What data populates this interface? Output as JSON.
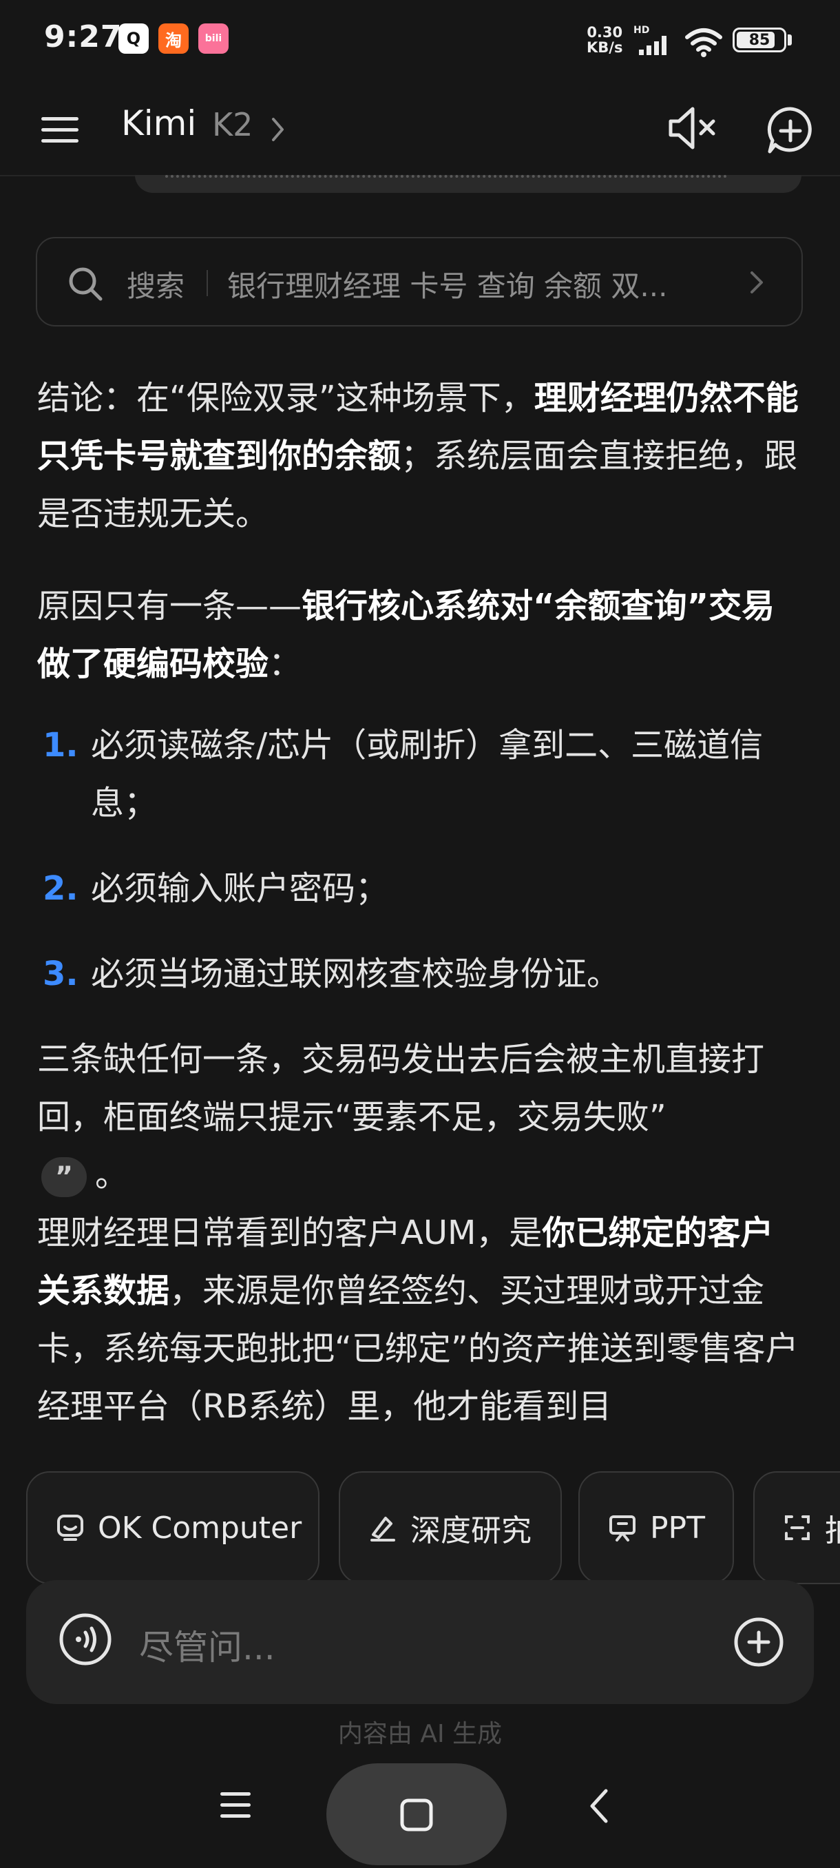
{
  "status_bar": {
    "time": "9:27",
    "app_icons": [
      {
        "name": "qq-icon",
        "glyph": "Q"
      },
      {
        "name": "taobao-icon",
        "glyph": "淘"
      },
      {
        "name": "bilibili-icon",
        "glyph": "bili"
      }
    ],
    "net_speed": "0.30",
    "net_unit": "KB/s",
    "hd_label": "HD",
    "battery": "85",
    "battery_level": 0.85
  },
  "header": {
    "title": "Kimi",
    "model": "K2"
  },
  "search": {
    "label": "搜索",
    "query": "银行理财经理 卡号 查询 余额 双..."
  },
  "message": {
    "p1_a": "结论：在“保险双录”这种场景下，",
    "p1_b": "理财经理仍然不能只凭卡号就查到你的余额",
    "p1_c": "；系统层面会直接拒绝，跟是否违规无关。",
    "p2_a": "原因只有一条——",
    "p2_b": "银行核心系统对“余额查询”交易做了硬编码校验",
    "p2_c": "：",
    "list": [
      {
        "num": "1.",
        "text": "必须读磁条/芯片（或刷折）拿到二、三磁道信息；"
      },
      {
        "num": "2.",
        "text": "必须输入账户密码；"
      },
      {
        "num": "3.",
        "text": "必须当场通过联网核查校验身份证。"
      }
    ],
    "p3": "三条缺任何一条，交易码发出去后会被主机直接打回，柜面终端只提示“要素不足，交易失败”",
    "cite": "”",
    "p3_end": "。",
    "p4_a": "理财经理日常看到的客户AUM，是",
    "p4_b": "你已绑定的客户关系数据",
    "p4_c": "，来源是你曾经签约、买过理财或开过金卡，系统每天跑批把“已绑定”的资产推送到零售客户经理平台（RB系统）里，他才能看到目"
  },
  "chips": [
    {
      "label": "OK Computer",
      "icon": "computer-icon"
    },
    {
      "label": "深度研究",
      "icon": "research-icon"
    },
    {
      "label": "PPT",
      "icon": "ppt-icon"
    },
    {
      "label": "拍",
      "icon": "scan-icon"
    }
  ],
  "input": {
    "placeholder": "尽管问..."
  },
  "disclaimer": "内容由 AI 生成",
  "colors": {
    "background": "#161616",
    "accent_number": "#3d8bff"
  }
}
